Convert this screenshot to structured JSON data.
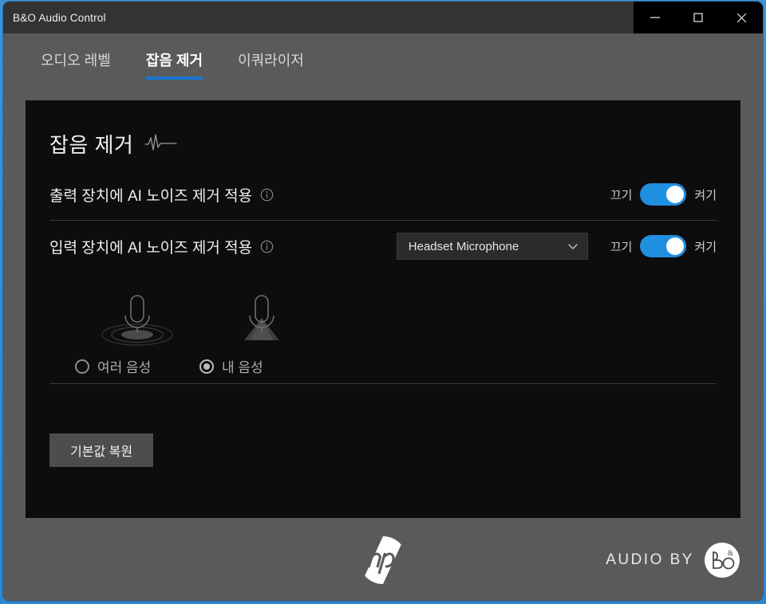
{
  "window": {
    "title": "B&O Audio Control",
    "controls": {
      "minimize_label": "—",
      "maximize_label": "□",
      "close_label": "✕"
    }
  },
  "tabs": [
    {
      "label": "오디오 레벨",
      "active": false
    },
    {
      "label": "잡음 제거",
      "active": true
    },
    {
      "label": "이쿼라이저",
      "active": false
    }
  ],
  "panel": {
    "title": "잡음 제거",
    "title_icon": "waveform-icon",
    "rows": [
      {
        "label": "출력 장치에 AI 노이즈 제거 적용",
        "info_icon": "info-icon",
        "toggle": {
          "off_label": "끄기",
          "on_label": "켜기",
          "state": "on"
        }
      },
      {
        "label": "입력 장치에 AI 노이즈 제거 적용",
        "info_icon": "info-icon",
        "dropdown": {
          "value": "Headset Microphone",
          "chevron": "chevron-down-icon"
        },
        "toggle": {
          "off_label": "끄기",
          "on_label": "켜기",
          "state": "on"
        }
      }
    ],
    "mic_options": [
      {
        "label": "여러 음성",
        "icon": "microphone-omni-icon",
        "selected": false
      },
      {
        "label": "내 음성",
        "icon": "microphone-directional-icon",
        "selected": true
      }
    ],
    "restore_button": "기본값 복원"
  },
  "footer": {
    "hp_logo": "hp-logo",
    "audio_by_text": "AUDIO BY",
    "bo_logo": "bang-olufsen-logo"
  },
  "colors": {
    "accent_blue": "#1f8fe0",
    "tab_underline": "#1976d2",
    "panel_background": "#0d0d0d",
    "window_chrome": "#5a5a5a",
    "titlebar": "#333333"
  }
}
